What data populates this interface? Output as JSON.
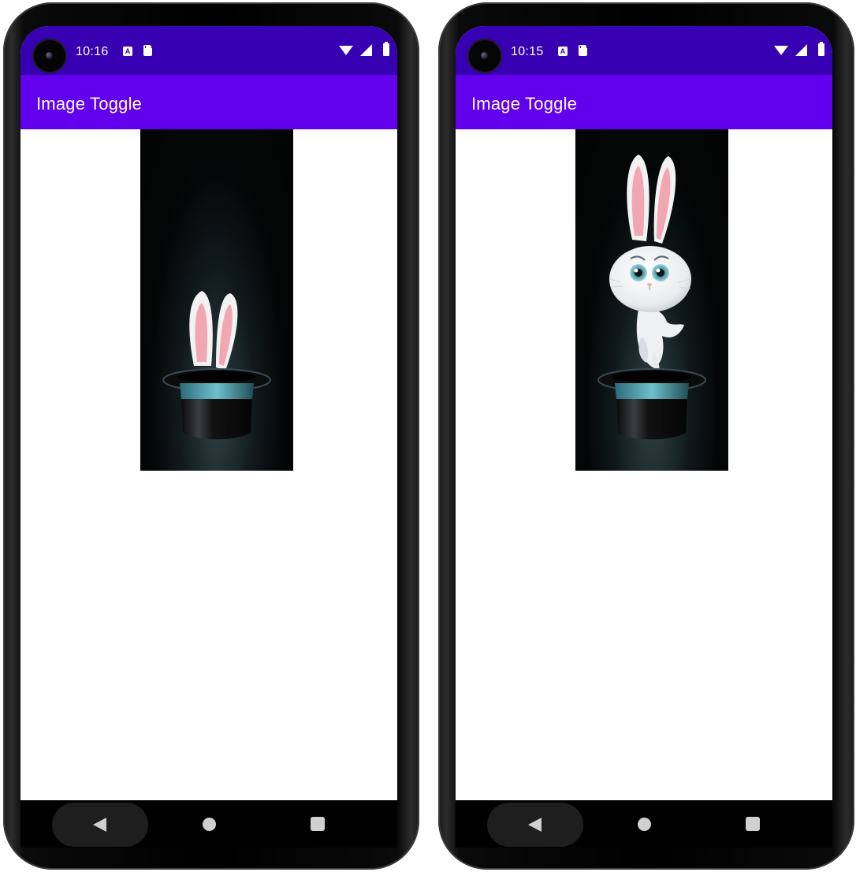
{
  "screens": [
    {
      "status_time": "10:16",
      "status_icon_a": "A",
      "app_title": "Image Toggle",
      "image_state": "rabbit-ears-in-hat"
    },
    {
      "status_time": "10:15",
      "status_icon_a": "A",
      "app_title": "Image Toggle",
      "image_state": "rabbit-jumping-from-hat"
    }
  ],
  "colors": {
    "status_bar": "#3700b3",
    "app_bar": "#6200ee",
    "content_bg": "#ffffff",
    "image_bg": "#030303"
  },
  "icons": {
    "status_left": [
      "keyboard-a-icon",
      "sd-card-icon"
    ],
    "status_right": [
      "wifi-icon",
      "signal-icon",
      "battery-icon"
    ],
    "nav": [
      "back-icon",
      "home-icon",
      "recents-icon"
    ]
  }
}
